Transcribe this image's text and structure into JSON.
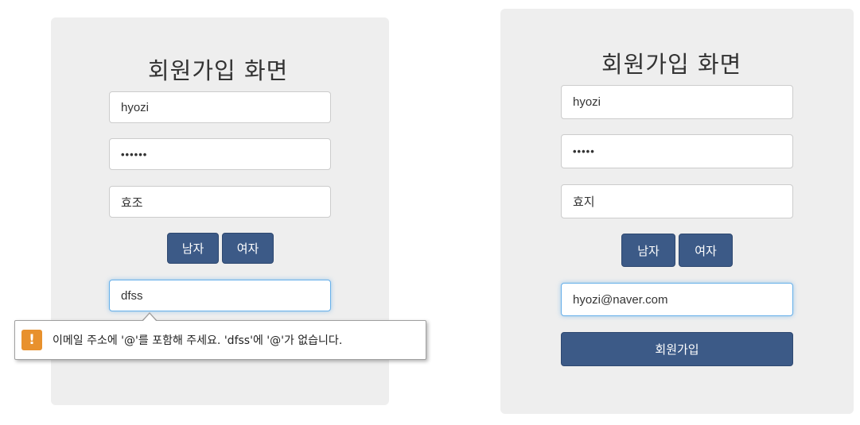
{
  "left_form": {
    "title": "회원가입 화면",
    "id_value": "hyozi",
    "password_value": "••••••",
    "name_value": "효조",
    "male_label": "남자",
    "female_label": "여자",
    "email_value": "dfss",
    "validation": {
      "icon": "warning-icon",
      "icon_glyph": "!",
      "message": "이메일 주소에 '@'를 포함해 주세요. 'dfss'에 '@'가 없습니다."
    }
  },
  "right_form": {
    "title": "회원가입 화면",
    "id_value": "hyozi",
    "password_value": "•••••",
    "name_value": "효지",
    "male_label": "남자",
    "female_label": "여자",
    "email_value": "hyozi@naver.com",
    "submit_label": "회원가입"
  },
  "colors": {
    "panel_bg": "#eeeeee",
    "button_bg": "#3c5a87",
    "focus_border": "#66afe9",
    "warning": "#e8912d"
  }
}
